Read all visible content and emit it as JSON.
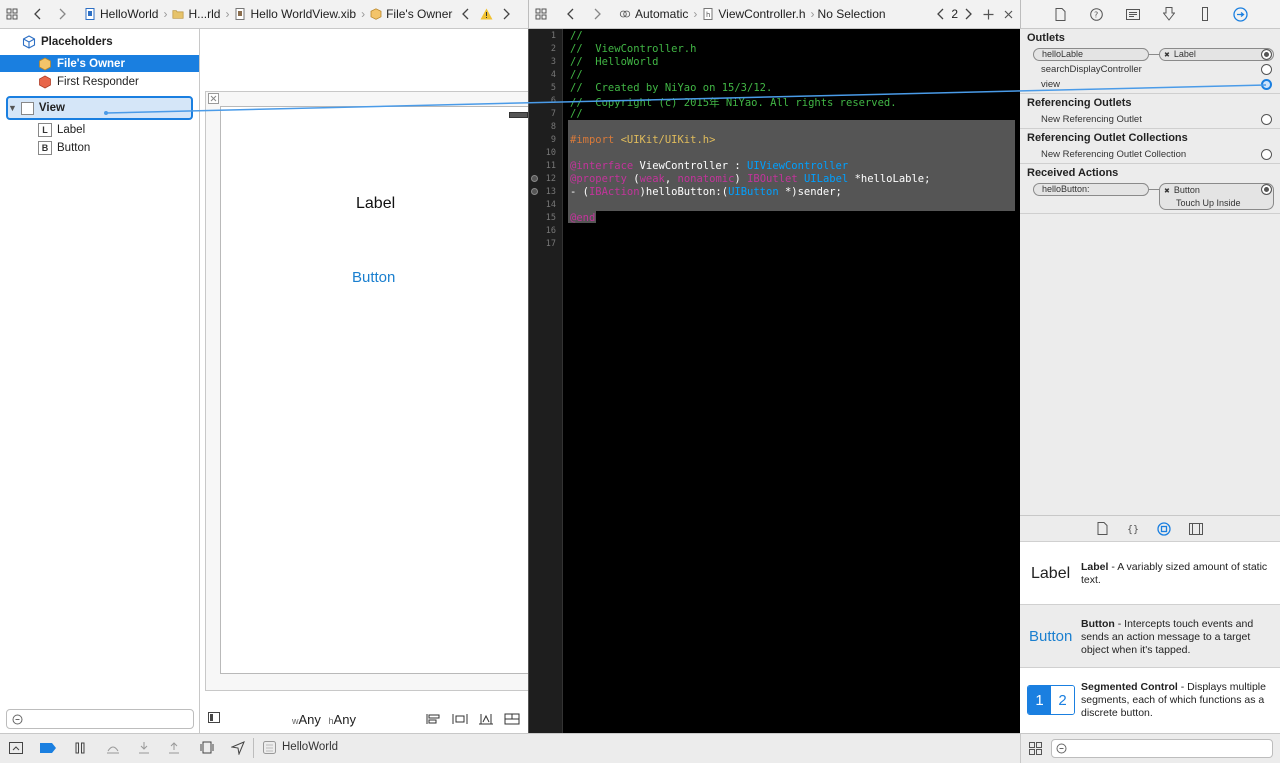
{
  "breadcrumb": {
    "project": "HelloWorld",
    "group": "H...rld",
    "file": "Hello WorldView.xib",
    "object": "File's Owner"
  },
  "assistant_bar": {
    "mode": "Automatic",
    "file": "ViewController.h",
    "selection": "No Selection",
    "counter": "2"
  },
  "outline": {
    "placeholders": "Placeholders",
    "files_owner": "File's Owner",
    "first_responder": "First Responder",
    "view": "View",
    "label": "Label",
    "button": "Button",
    "label_badge": "L",
    "button_badge": "B"
  },
  "canvas": {
    "label_text": "Label",
    "button_text": "Button",
    "size_w_prefix": "w",
    "size_w": "Any",
    "size_h_prefix": "h",
    "size_h": "Any"
  },
  "code": {
    "line_numbers": [
      "1",
      "2",
      "3",
      "4",
      "5",
      "6",
      "7",
      "8",
      "9",
      "10",
      "11",
      "12",
      "13",
      "14",
      "15",
      "16",
      "17"
    ],
    "l1": "//",
    "l2": "//  ViewController.h",
    "l3": "//  HelloWorld",
    "l4": "//",
    "l5": "//  Created by NiYao on 15/3/12.",
    "l6": "//  Copyright (c) 2015年 NiYao. All rights reserved.",
    "l7": "//",
    "l9_kw": "#import",
    "l9_rest": "<UIKit/UIKit.h>",
    "l11_kw": "@interface",
    "l11_name": "ViewController",
    "l11_colon": ":",
    "l11_super": "UIViewController",
    "l12_kw": "@property",
    "l12_open": "(",
    "l12_weak": "weak",
    "l12_comma": ",",
    "l12_nonatomic": "nonatomic",
    "l12_close": ")",
    "l12_iboutlet": "IBOutlet",
    "l12_type": "UILabel",
    "l12_var": "*helloLable;",
    "l13_dash": "- (",
    "l13_ibaction": "IBAction",
    "l13_method": ")helloButton:(",
    "l13_type": "UIButton",
    "l13_rest": "*)sender;",
    "l15_kw": "@end"
  },
  "inspector": {
    "outlets": "Outlets",
    "outlet1_name": "helloLable",
    "outlet1_target": "Label",
    "outlet2_name": "searchDisplayController",
    "outlet3_name": "view",
    "ref_outlets": "Referencing Outlets",
    "new_ref_outlet": "New Referencing Outlet",
    "ref_collections": "Referencing Outlet Collections",
    "new_ref_collection": "New Referencing Outlet Collection",
    "received_actions": "Received Actions",
    "action1_name": "helloButton:",
    "action1_target": "Button",
    "action1_event": "Touch Up Inside",
    "close_mark": "✖"
  },
  "library": {
    "label_preview": "Label",
    "label_title": "Label",
    "label_desc": " - A variably sized amount of static text.",
    "button_preview": "Button",
    "button_title": "Button",
    "button_desc": " - Intercepts touch events and sends an action message to a target object when it's tapped.",
    "seg_1": "1",
    "seg_2": "2",
    "seg_title": "Segmented Control",
    "seg_desc": " - Displays multiple segments, each of which functions as a discrete button."
  },
  "bottombar": {
    "scheme": "HelloWorld"
  },
  "colors": {
    "selection": "#1a7fe0",
    "comment": "#41b645",
    "keyword": "#c2349b",
    "type": "#00a0ff",
    "string": "#e0bc5c",
    "highlight": "#555555"
  }
}
